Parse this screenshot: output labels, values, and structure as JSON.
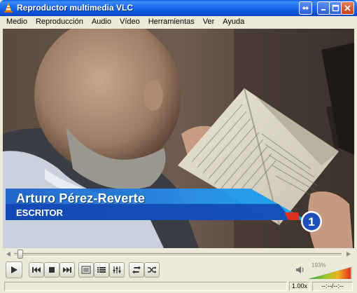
{
  "window": {
    "title": "Reproductor multimedia VLC"
  },
  "menu": [
    "Medio",
    "Reproducción",
    "Audio",
    "Vídeo",
    "Herramientas",
    "Ver",
    "Ayuda"
  ],
  "video": {
    "lower_third": {
      "name": "Arturo Pérez-Reverte",
      "role": "ESCRITOR"
    },
    "channel_logo": "1"
  },
  "seek": {
    "position_fraction": 0.02
  },
  "controls": {
    "buttons": [
      "play-icon",
      "previous-icon",
      "stop-icon",
      "next-icon",
      "fullscreen-icon",
      "playlist-icon",
      "extended-settings-icon",
      "loop-icon",
      "random-icon"
    ]
  },
  "volume": {
    "label": "193%",
    "level_fraction": 0.97
  },
  "status": {
    "speed": "1.00x",
    "time": "--:--/--:--"
  },
  "colors": {
    "titlebar": "#0752d6",
    "lower_third": "#1f6fd8",
    "accent_red": "#e0301e"
  }
}
